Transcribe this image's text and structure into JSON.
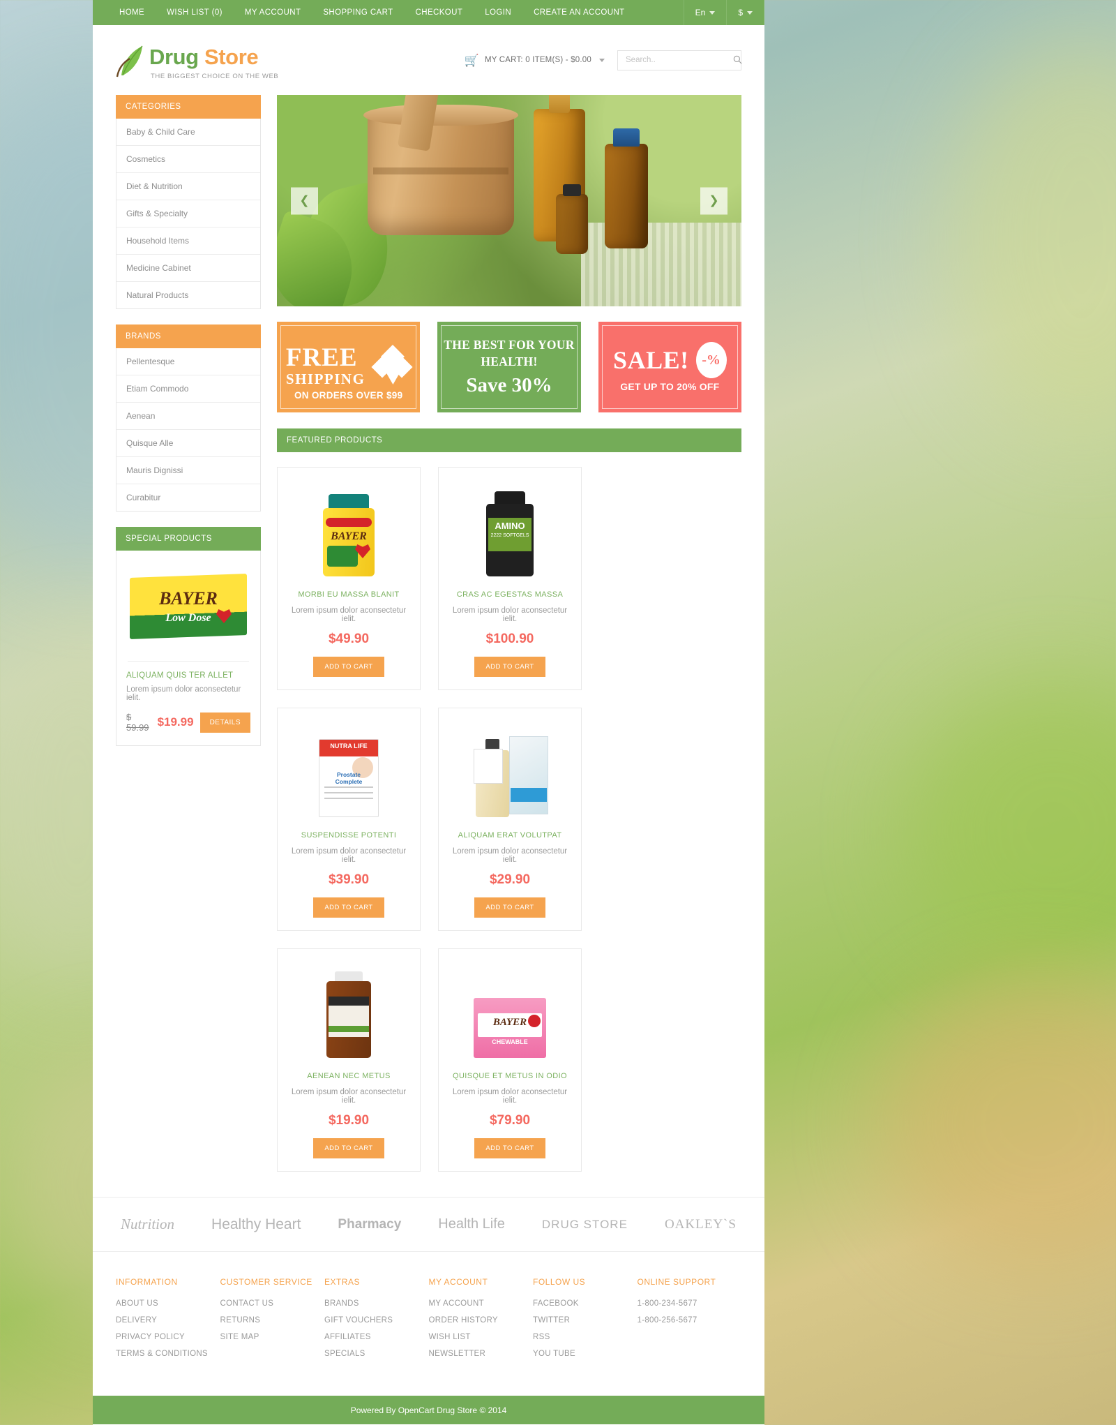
{
  "topbar": {
    "nav": [
      {
        "label": "HOME"
      },
      {
        "label": "WISH LIST (0)"
      },
      {
        "label": "MY ACCOUNT"
      },
      {
        "label": "SHOPPING CART"
      },
      {
        "label": "CHECKOUT"
      },
      {
        "label": "LOGIN"
      },
      {
        "label": "CREATE AN ACCOUNT"
      }
    ],
    "language": "En",
    "currency": "$"
  },
  "header": {
    "logo_primary": "Drug",
    "logo_secondary": "Store",
    "tagline": "THE BIGGEST CHOICE  ON THE WEB",
    "cart_label": "MY CART: 0 ITEM(S) - $0.00",
    "search_placeholder": "Search.."
  },
  "sidebar": {
    "categories": {
      "title": "CATEGORIES",
      "items": [
        "Baby & Child Care",
        "Cosmetics",
        "Diet & Nutrition",
        "Gifts & Specialty",
        "Household Items",
        "Medicine Cabinet",
        "Natural Products"
      ]
    },
    "brands": {
      "title": "BRANDS",
      "items": [
        "Pellentesque",
        "Etiam Commodo",
        "Aenean",
        "Quisque Alle",
        "Mauris Dignissi",
        "Curabitur"
      ]
    },
    "special": {
      "title": "SPECIAL PRODUCTS",
      "product_name": "ALIQUAM QUIS TER ALLET",
      "product_desc": "Lorem ipsum dolor  aconsectetur ielit.",
      "old_price": "$ 59.99",
      "new_price": "$19.99",
      "details_label": "DETAILS"
    }
  },
  "slider": {
    "prev_icon": "chevron-left",
    "next_icon": "chevron-right"
  },
  "promos": [
    {
      "id": "free-shipping",
      "line1": "FREE",
      "line2": "SHIPPING",
      "line3": "ON ORDERS OVER $99",
      "color": "#f5a34e"
    },
    {
      "id": "best-health",
      "line1": "THE BEST FOR YOUR HEALTH!",
      "line2": "Save 30%",
      "color": "#74ac58"
    },
    {
      "id": "sale",
      "line1": "SALE!",
      "badge": "-%",
      "line2": "GET UP TO 20% OFF",
      "color": "#f9706b"
    }
  ],
  "featured": {
    "title": "FEATURED PRODUCTS",
    "add_to_cart_label": "ADD TO CART",
    "products": [
      {
        "name": "MORBI EU MASSA BLANIT",
        "desc": "Lorem ipsum dolor  aconsectetur ielit.",
        "price": "$49.90",
        "art": "bayer-bottle"
      },
      {
        "name": "CRAS AC EGESTAS MASSA",
        "desc": "Lorem ipsum dolor  aconsectetur ielit.",
        "price": "$100.90",
        "art": "amino-bottle"
      },
      {
        "name": "SUSPENDISSE POTENTI",
        "desc": "Lorem ipsum dolor  aconsectetur ielit.",
        "price": "$39.90",
        "art": "nutralife-box"
      },
      {
        "name": "ALIQUAM ERAT VOLUTPAT",
        "desc": "Lorem ipsum dolor  aconsectetur ielit.",
        "price": "$29.90",
        "art": "liquid-bottle"
      },
      {
        "name": "AENEAN NEC METUS",
        "desc": "Lorem ipsum dolor  aconsectetur ielit.",
        "price": "$19.90",
        "art": "blackmores-bottle"
      },
      {
        "name": "QUISQUE ET METUS IN ODIO",
        "desc": "Lorem ipsum dolor  aconsectetur ielit.",
        "price": "$79.90",
        "art": "bayer-chewable"
      }
    ]
  },
  "brand_logos": [
    "Nutrition",
    "Healthy Heart",
    "Pharmacy",
    "Health Life",
    "DRUG  STORE",
    "OAKLEY`S"
  ],
  "footer": {
    "columns": [
      {
        "title": "INFORMATION",
        "links": [
          "ABOUT US",
          "DELIVERY",
          "PRIVACY POLICY",
          "TERMS & CONDITIONS"
        ]
      },
      {
        "title": "CUSTOMER SERVICE",
        "links": [
          "CONTACT US",
          "RETURNS",
          "SITE MAP"
        ]
      },
      {
        "title": "EXTRAS",
        "links": [
          "BRANDS",
          "GIFT VOUCHERS",
          "AFFILIATES",
          "SPECIALS"
        ]
      },
      {
        "title": "MY ACCOUNT",
        "links": [
          "MY ACCOUNT",
          "ORDER HISTORY",
          "WISH LIST",
          "NEWSLETTER"
        ]
      },
      {
        "title": "FOLLOW US",
        "links": [
          "FACEBOOK",
          "TWITTER",
          "RSS",
          "YOU TUBE"
        ]
      },
      {
        "title": "ONLINE SUPPORT",
        "links": [
          "1-800-234-5677",
          "1-800-256-5677"
        ]
      }
    ],
    "copyright": "Powered By OpenCart  Drug Store © 2014"
  },
  "colors": {
    "green": "#74ac58",
    "orange": "#f5a34e",
    "red": "#f4685f",
    "pink": "#f9706b"
  }
}
